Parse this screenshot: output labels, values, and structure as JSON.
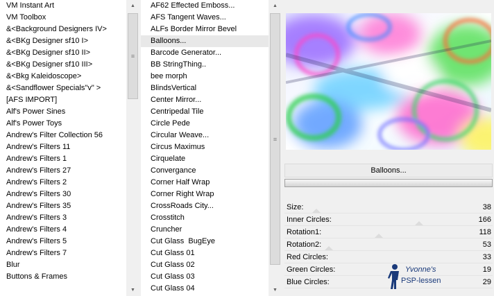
{
  "categories": {
    "items": [
      "VM Instant Art",
      "VM Toolbox",
      "&<Background Designers IV>",
      "&<BKg Designer sf10 I>",
      "&<BKg Designer sf10 II>",
      "&<BKg Designer sf10 III>",
      "&<Bkg Kaleidoscope>",
      "&<Sandflower Specials\"v\" >",
      "[AFS IMPORT]",
      "Alf's Power Sines",
      "Alf's Power Toys",
      "Andrew's Filter Collection 56",
      "Andrew's Filters 11",
      "Andrew's Filters 1",
      "Andrew's Filters 27",
      "Andrew's Filters 2",
      "Andrew's Filters 30",
      "Andrew's Filters 35",
      "Andrew's Filters 3",
      "Andrew's Filters 4",
      "Andrew's Filters 5",
      "Andrew's Filters 7",
      "Blur",
      "Buttons & Frames"
    ]
  },
  "filters": {
    "items": [
      "AF62 Effected Emboss...",
      "AFS Tangent Waves...",
      "ALFs Border Mirror Bevel",
      "Balloons...",
      "Barcode Generator...",
      "BB StringThing..",
      "bee morph",
      "BlindsVertical",
      "Center Mirror...",
      "Centripedal Tile",
      "Circle Pede",
      "Circular Weave...",
      "Circus Maximus",
      "Cirquelate",
      "Convergance",
      "Corner Half Wrap",
      "Corner Right Wrap",
      "CrossRoads City...",
      "Crosstitch",
      "Cruncher",
      "Cut Glass  BugEye",
      "Cut Glass 01",
      "Cut Glass 02",
      "Cut Glass 03",
      "Cut Glass 04"
    ],
    "selected_index": 3
  },
  "selected_filter_label": "Balloons...",
  "params": [
    {
      "label": "Size:",
      "value": "38"
    },
    {
      "label": "Inner Circles:",
      "value": "166"
    },
    {
      "label": "Rotation1:",
      "value": "118"
    },
    {
      "label": "Rotation2:",
      "value": "53"
    },
    {
      "label": "Red Circles:",
      "value": "33"
    },
    {
      "label": "Green Circles:",
      "value": "19"
    },
    {
      "label": "Blue Circles:",
      "value": "29"
    }
  ],
  "watermark": {
    "name": "Yvonne's",
    "subtitle": "PSP-lessen",
    "color": "#1a3a7a"
  },
  "icons": {
    "scroll_up": "▲",
    "scroll_down": "▼",
    "grip": "≡"
  }
}
